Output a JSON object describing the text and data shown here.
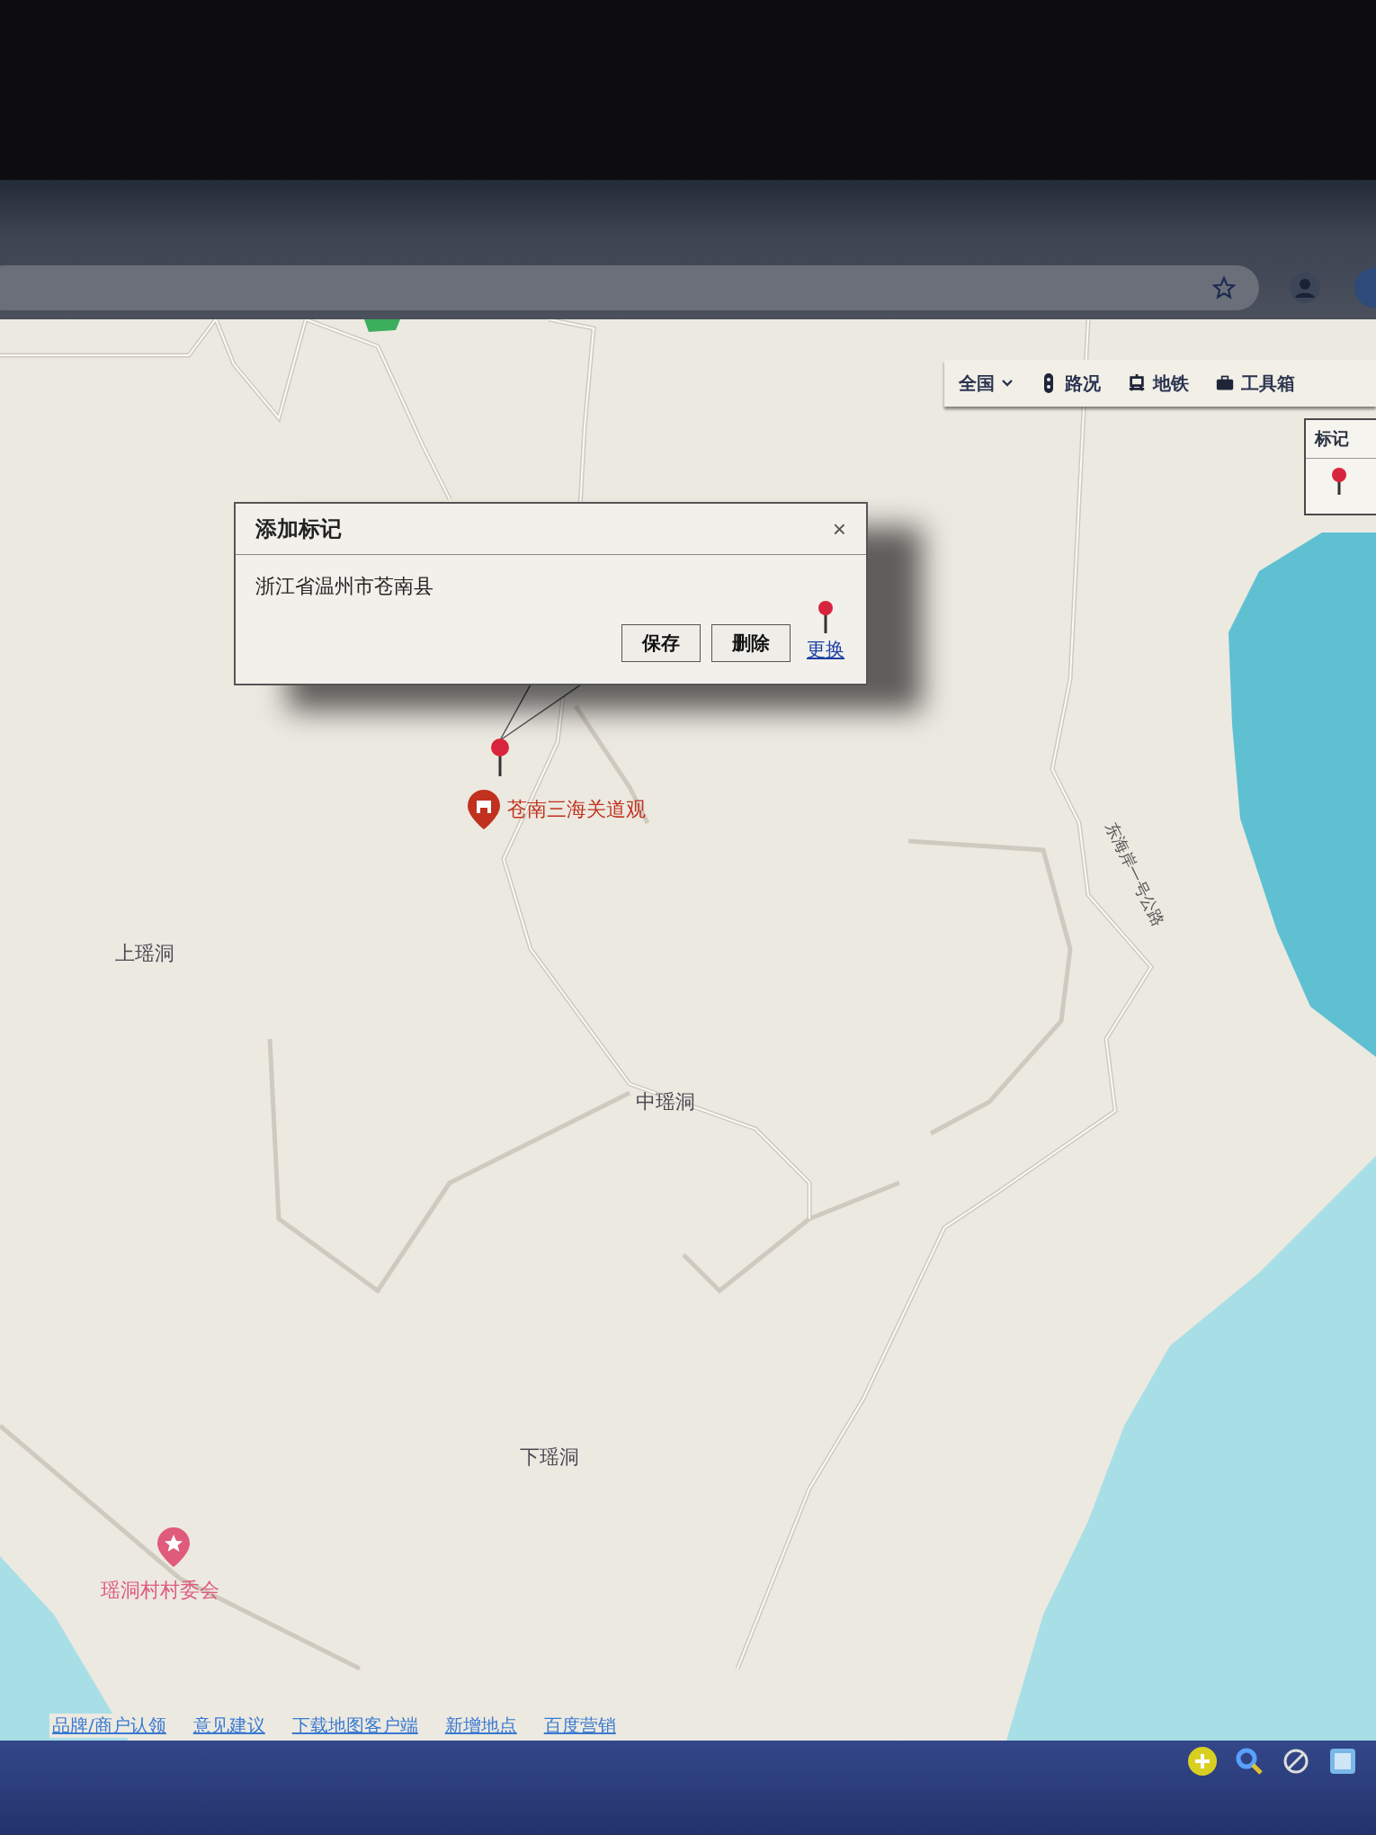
{
  "toolbar": {
    "items": [
      {
        "label": "全国",
        "kind": "dropdown"
      },
      {
        "label": "路况",
        "kind": "traffic"
      },
      {
        "label": "地铁",
        "kind": "subway"
      },
      {
        "label": "工具箱",
        "kind": "toolbox"
      }
    ]
  },
  "marker_panel": {
    "title": "标记"
  },
  "dialog": {
    "title": "添加标记",
    "close": "×",
    "address": "浙江省温州市苍南县",
    "buttons": [
      "保存",
      "删除"
    ],
    "link": "更换"
  },
  "map_labels": [
    {
      "text": "苍南三海关道观",
      "kind": "poi"
    },
    {
      "text": "上瑶洞",
      "kind": "place"
    },
    {
      "text": "中瑶洞",
      "kind": "place"
    },
    {
      "text": "东海岸一号公路",
      "kind": "road"
    },
    {
      "text": "下瑶洞",
      "kind": "place"
    },
    {
      "text": "瑶洞村村委会",
      "kind": "office"
    }
  ],
  "footer_links": [
    "品牌/商户认领",
    "意见建议",
    "下载地图客户端",
    "新增地点",
    "百度营销"
  ]
}
